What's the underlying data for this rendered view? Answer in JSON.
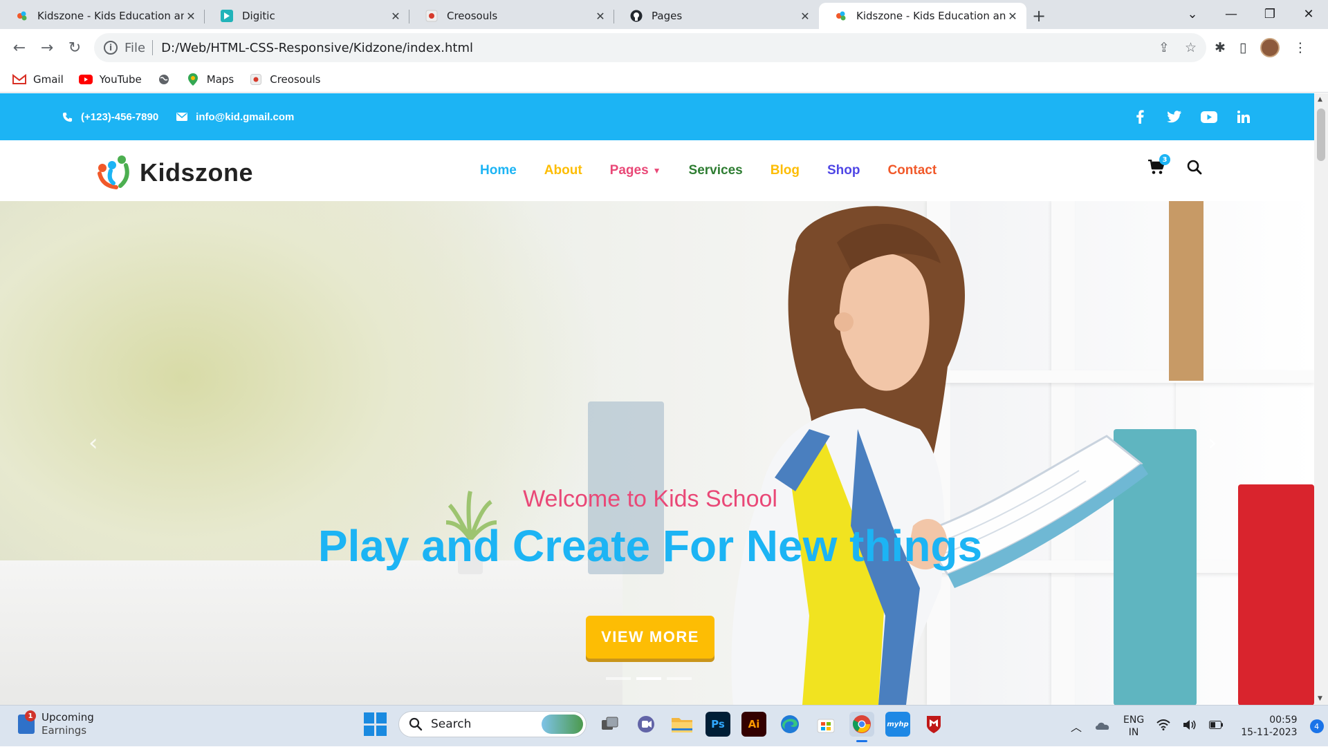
{
  "browser": {
    "tabs": [
      {
        "title": "Kidszone - Kids Education and Scho",
        "favicon": "kidszone-icon",
        "active": false
      },
      {
        "title": "Digitic",
        "favicon": "digitic-icon",
        "active": false
      },
      {
        "title": "Creosouls",
        "favicon": "creosouls-icon",
        "active": false
      },
      {
        "title": "Pages",
        "favicon": "github-icon",
        "active": false
      },
      {
        "title": "Kidszone - Kids Education and Scho",
        "favicon": "kidszone-icon",
        "active": true
      }
    ],
    "url_scheme": "File",
    "url": "D:/Web/HTML-CSS-Responsive/Kidzone/index.html",
    "bookmarks": [
      {
        "label": "Gmail",
        "icon": "gmail-icon"
      },
      {
        "label": "YouTube",
        "icon": "youtube-icon"
      },
      {
        "label": "",
        "icon": "globe-icon"
      },
      {
        "label": "Maps",
        "icon": "maps-icon"
      },
      {
        "label": "Creosouls",
        "icon": "creosouls-icon"
      }
    ]
  },
  "site": {
    "topbar": {
      "phone": "(+123)-456-7890",
      "email": "info@kid.gmail.com",
      "social": [
        "facebook-icon",
        "twitter-icon",
        "youtube-icon",
        "linkedin-icon"
      ]
    },
    "brand": "Kidszone",
    "menu": [
      {
        "label": "Home",
        "color": "#1cb4f4"
      },
      {
        "label": "About",
        "color": "#fdbd04"
      },
      {
        "label": "Pages",
        "color": "#e94877"
      },
      {
        "label": "Services",
        "color": "#2e7d32"
      },
      {
        "label": "Blog",
        "color": "#fdbd04"
      },
      {
        "label": "Shop",
        "color": "#4f46e5"
      },
      {
        "label": "Contact",
        "color": "#f1592a"
      }
    ],
    "cart_count": "3",
    "hero": {
      "subtitle": "Welcome to Kids School",
      "title": "Play and Create For New things",
      "button": "VIEW MORE",
      "slide_total": 3,
      "slide_active": 2
    },
    "colors": {
      "primary": "#1cb4f4",
      "accent": "#fdbd04",
      "pink": "#e94877"
    }
  },
  "taskbar": {
    "weather_badge": "1",
    "weather_title": "Upcoming",
    "weather_sub": "Earnings",
    "search_placeholder": "Search",
    "apps": [
      "file-explorer-icon",
      "teams-icon",
      "folder-icon",
      "photoshop-icon",
      "illustrator-icon",
      "edge-icon",
      "store-icon",
      "chrome-icon",
      "myhp-icon",
      "mcafee-icon"
    ],
    "lang_top": "ENG",
    "lang_bottom": "IN",
    "time": "00:59",
    "date": "15-11-2023",
    "notifications": "4"
  }
}
